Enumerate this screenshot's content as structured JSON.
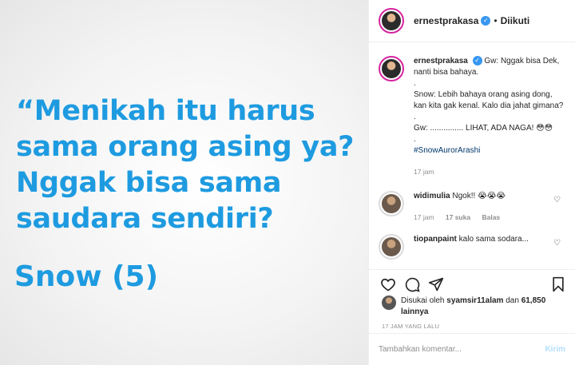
{
  "media": {
    "quote_lines": [
      "“Menikah itu harus",
      "sama orang asing ya?",
      "Nggak bisa sama",
      "saudara sendiri?"
    ],
    "author": "Snow (5)"
  },
  "header": {
    "username": "ernestprakasa",
    "separator": "•",
    "follow_status": "Diikuti"
  },
  "caption": {
    "username": "ernestprakasa",
    "lines": [
      "Gw: Nggak bisa Dek, nanti bisa bahaya.",
      ".",
      "Snow: Lebih bahaya orang asing dong, kan kita gak kenal. Kalo dia jahat gimana?",
      ".",
      "Gw: ............... LIHAT, ADA NAGA! 😳😳",
      "."
    ],
    "hashtag": "#SnowAurorArashi",
    "time": "17 jam"
  },
  "comments": [
    {
      "username": "widimulia",
      "text": "Ngok!! 😭😭😭",
      "time": "17 jam",
      "likes": "17 suka",
      "reply": "Balas"
    },
    {
      "username": "tiopanpaint",
      "text": "kalo sama sodara..."
    }
  ],
  "actions": {
    "liked_by_prefix": "Disukai oleh",
    "liked_by_user": "syamsir11alam",
    "liked_by_and": "dan",
    "liked_by_count": "61,850 lainnya",
    "timestamp": "17 JAM YANG LALU"
  },
  "add_comment": {
    "placeholder": "Tambahkan komentar...",
    "post_label": "Kirim"
  },
  "colors": {
    "quote_blue": "#1e9be0",
    "verified_blue": "#3897f0",
    "post_disabled": "#b2dffc"
  }
}
